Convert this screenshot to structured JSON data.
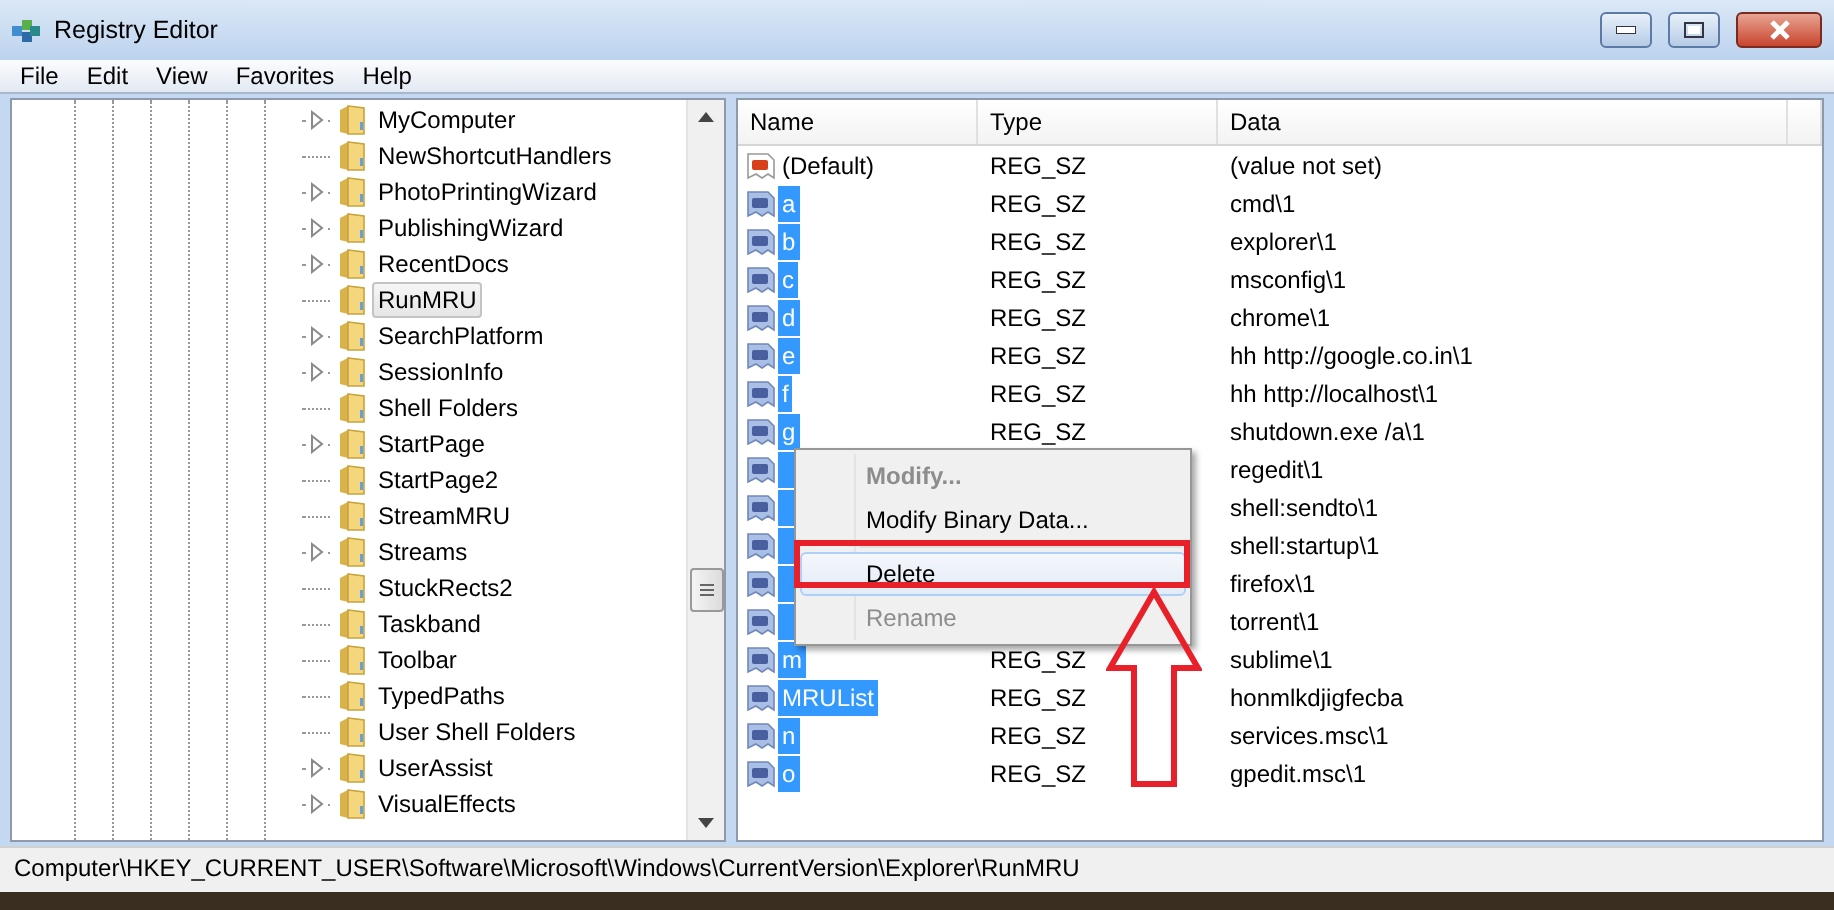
{
  "window": {
    "title": "Registry Editor"
  },
  "menu": [
    "File",
    "Edit",
    "View",
    "Favorites",
    "Help"
  ],
  "tree": {
    "items": [
      {
        "label": "MyComputer",
        "expandable": true,
        "selected": false
      },
      {
        "label": "NewShortcutHandlers",
        "expandable": false,
        "selected": false
      },
      {
        "label": "PhotoPrintingWizard",
        "expandable": true,
        "selected": false
      },
      {
        "label": "PublishingWizard",
        "expandable": true,
        "selected": false
      },
      {
        "label": "RecentDocs",
        "expandable": true,
        "selected": false
      },
      {
        "label": "RunMRU",
        "expandable": false,
        "selected": true
      },
      {
        "label": "SearchPlatform",
        "expandable": true,
        "selected": false
      },
      {
        "label": "SessionInfo",
        "expandable": true,
        "selected": false
      },
      {
        "label": "Shell Folders",
        "expandable": false,
        "selected": false
      },
      {
        "label": "StartPage",
        "expandable": true,
        "selected": false
      },
      {
        "label": "StartPage2",
        "expandable": false,
        "selected": false
      },
      {
        "label": "StreamMRU",
        "expandable": false,
        "selected": false
      },
      {
        "label": "Streams",
        "expandable": true,
        "selected": false
      },
      {
        "label": "StuckRects2",
        "expandable": false,
        "selected": false
      },
      {
        "label": "Taskband",
        "expandable": false,
        "selected": false
      },
      {
        "label": "Toolbar",
        "expandable": false,
        "selected": false
      },
      {
        "label": "TypedPaths",
        "expandable": false,
        "selected": false
      },
      {
        "label": "User Shell Folders",
        "expandable": false,
        "selected": false
      },
      {
        "label": "UserAssist",
        "expandable": true,
        "selected": false
      },
      {
        "label": "VisualEffects",
        "expandable": true,
        "selected": false
      }
    ]
  },
  "list": {
    "columns": [
      "Name",
      "Type",
      "Data"
    ],
    "rows": [
      {
        "name": "(Default)",
        "type": "REG_SZ",
        "data": "(value not set)",
        "selected": false
      },
      {
        "name": "a",
        "type": "REG_SZ",
        "data": "cmd\\1",
        "selected": true
      },
      {
        "name": "b",
        "type": "REG_SZ",
        "data": "explorer\\1",
        "selected": true
      },
      {
        "name": "c",
        "type": "REG_SZ",
        "data": "msconfig\\1",
        "selected": true
      },
      {
        "name": "d",
        "type": "REG_SZ",
        "data": "chrome\\1",
        "selected": true
      },
      {
        "name": "e",
        "type": "REG_SZ",
        "data": "hh http://google.co.in\\1",
        "selected": true
      },
      {
        "name": "f",
        "type": "REG_SZ",
        "data": "hh http://localhost\\1",
        "selected": true
      },
      {
        "name": "g",
        "type": "REG_SZ",
        "data": "shutdown.exe /a\\1",
        "selected": true
      },
      {
        "data": "regedit\\1",
        "selected": true
      },
      {
        "data": "shell:sendto\\1",
        "selected": true
      },
      {
        "data": "shell:startup\\1",
        "selected": true
      },
      {
        "data": "firefox\\1",
        "selected": true
      },
      {
        "data": "torrent\\1",
        "selected": true
      },
      {
        "name": "m",
        "type": "REG_SZ",
        "data": "sublime\\1",
        "selected": true
      },
      {
        "name": "MRUList",
        "type": "REG_SZ",
        "data": "honmlkdjigfecba",
        "selected": true
      },
      {
        "name": "n",
        "type": "REG_SZ",
        "data": "services.msc\\1",
        "selected": true
      },
      {
        "name": "o",
        "type": "REG_SZ",
        "data": "gpedit.msc\\1",
        "selected": true
      }
    ]
  },
  "context_menu": {
    "items": [
      {
        "kind": "item",
        "label": "Modify...",
        "bold": true,
        "disabled": true,
        "selected": false
      },
      {
        "kind": "item",
        "label": "Modify Binary Data...",
        "bold": false,
        "disabled": false,
        "selected": false
      },
      {
        "kind": "separator"
      },
      {
        "kind": "item",
        "label": "Delete",
        "bold": false,
        "disabled": false,
        "selected": true
      },
      {
        "kind": "item",
        "label": "Rename",
        "bold": false,
        "disabled": true,
        "selected": false
      }
    ]
  },
  "status_bar": "Computer\\HKEY_CURRENT_USER\\Software\\Microsoft\\Windows\\CurrentVersion\\Explorer\\RunMRU"
}
